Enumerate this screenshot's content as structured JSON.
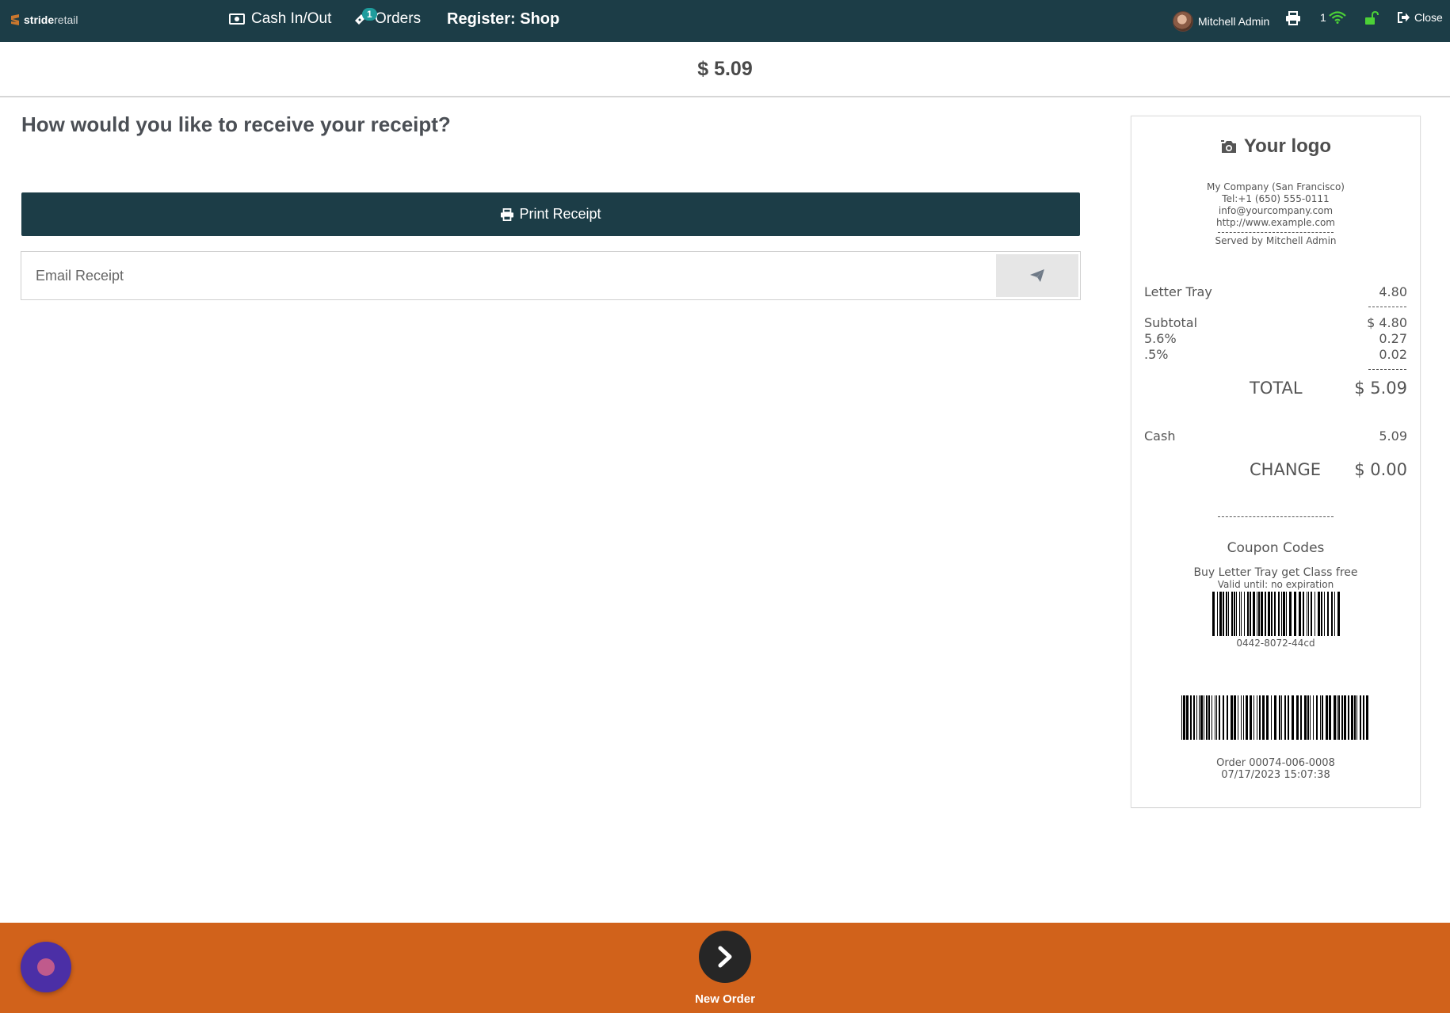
{
  "topbar": {
    "brand_bold": "stride",
    "brand_light": "retail",
    "cash_label": "Cash In/Out",
    "orders_label": "Orders",
    "orders_badge": "1",
    "register_label": "Register: Shop",
    "user_name": "Mitchell Admin",
    "connection_count": "1",
    "close_label": "Close"
  },
  "amount": "$ 5.09",
  "receipt_options": {
    "question": "How would you like to receive your receipt?",
    "print_label": "Print Receipt",
    "email_placeholder": "Email Receipt"
  },
  "receipt": {
    "logo_text": "Your logo",
    "company": "My Company (San Francisco)",
    "tel": "Tel:+1 (650) 555-0111",
    "email": "info@yourcompany.com",
    "website": "http://www.example.com",
    "served_by": "Served by Mitchell Admin",
    "line_item_name": "Letter Tray",
    "line_item_price": "4.80",
    "subtotal_label": "Subtotal",
    "subtotal_value": "$ 4.80",
    "tax1_label": "5.6%",
    "tax1_value": "0.27",
    "tax2_label": ".5%",
    "tax2_value": "0.02",
    "total_label": "TOTAL",
    "total_value": "$ 5.09",
    "payment_label": "Cash",
    "payment_value": "5.09",
    "change_label": "CHANGE",
    "change_value": "$ 0.00",
    "coupon_title": "Coupon Codes",
    "coupon_name": "Buy Letter Tray get Class free",
    "coupon_validity": "Valid until: no expiration",
    "coupon_code": "0442-8072-44cd",
    "order_ref": "Order 00074-006-0008",
    "order_date": "07/17/2023 15:07:38"
  },
  "bottom": {
    "new_order_label": "New Order"
  },
  "colors": {
    "topbar": "#1c3d47",
    "bottombar": "#d1621b",
    "badge": "#1e9c9c",
    "wifi": "#4cd137",
    "lock": "#4cd137"
  }
}
